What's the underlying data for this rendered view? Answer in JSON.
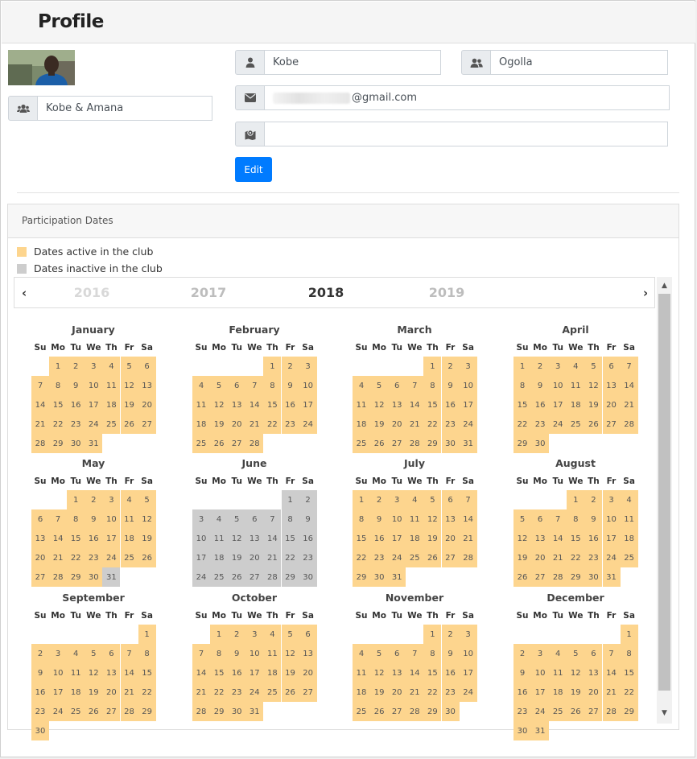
{
  "page": {
    "title": "Profile"
  },
  "profile": {
    "first_name": "Kobe",
    "last_name": "Ogolla",
    "email_domain": "@gmail.com",
    "team": "Kobe & Amana",
    "location": "",
    "edit_label": "Edit"
  },
  "participation": {
    "header": "Participation Dates",
    "legend": [
      {
        "label": "Dates active in the club",
        "color": "#fdd58e"
      },
      {
        "label": "Dates inactive in the club",
        "color": "#cdcdcd"
      }
    ],
    "nav": {
      "prev": "‹",
      "next": "›"
    },
    "years": [
      {
        "label": "2016",
        "color": "#d8d8d8",
        "state": "far"
      },
      {
        "label": "2017",
        "color": "#bdbdbd",
        "state": "near"
      },
      {
        "label": "2018",
        "color": "#333333",
        "state": "current"
      },
      {
        "label": "2019",
        "color": "#bdbdbd",
        "state": "near"
      }
    ],
    "weekdays": [
      "Su",
      "Mo",
      "Tu",
      "We",
      "Th",
      "Fr",
      "Sa"
    ],
    "months": [
      {
        "name": "January",
        "days": 31,
        "start": 1,
        "inactive": []
      },
      {
        "name": "February",
        "days": 28,
        "start": 4,
        "inactive": []
      },
      {
        "name": "March",
        "days": 31,
        "start": 4,
        "inactive": []
      },
      {
        "name": "April",
        "days": 30,
        "start": 0,
        "inactive": []
      },
      {
        "name": "May",
        "days": 31,
        "start": 2,
        "inactive": [
          31
        ]
      },
      {
        "name": "June",
        "days": 30,
        "start": 5,
        "inactive": [
          1,
          2,
          3,
          4,
          5,
          6,
          7,
          8,
          9,
          10,
          11,
          12,
          13,
          14,
          15,
          16,
          17,
          18,
          19,
          20,
          21,
          22,
          23,
          24,
          25,
          26,
          27,
          28,
          29,
          30
        ]
      },
      {
        "name": "July",
        "days": 31,
        "start": 0,
        "inactive": []
      },
      {
        "name": "August",
        "days": 31,
        "start": 3,
        "inactive": []
      },
      {
        "name": "September",
        "days": 30,
        "start": 6,
        "inactive": []
      },
      {
        "name": "October",
        "days": 31,
        "start": 1,
        "inactive": []
      },
      {
        "name": "November",
        "days": 30,
        "start": 4,
        "inactive": []
      },
      {
        "name": "December",
        "days": 31,
        "start": 6,
        "inactive": []
      }
    ]
  }
}
